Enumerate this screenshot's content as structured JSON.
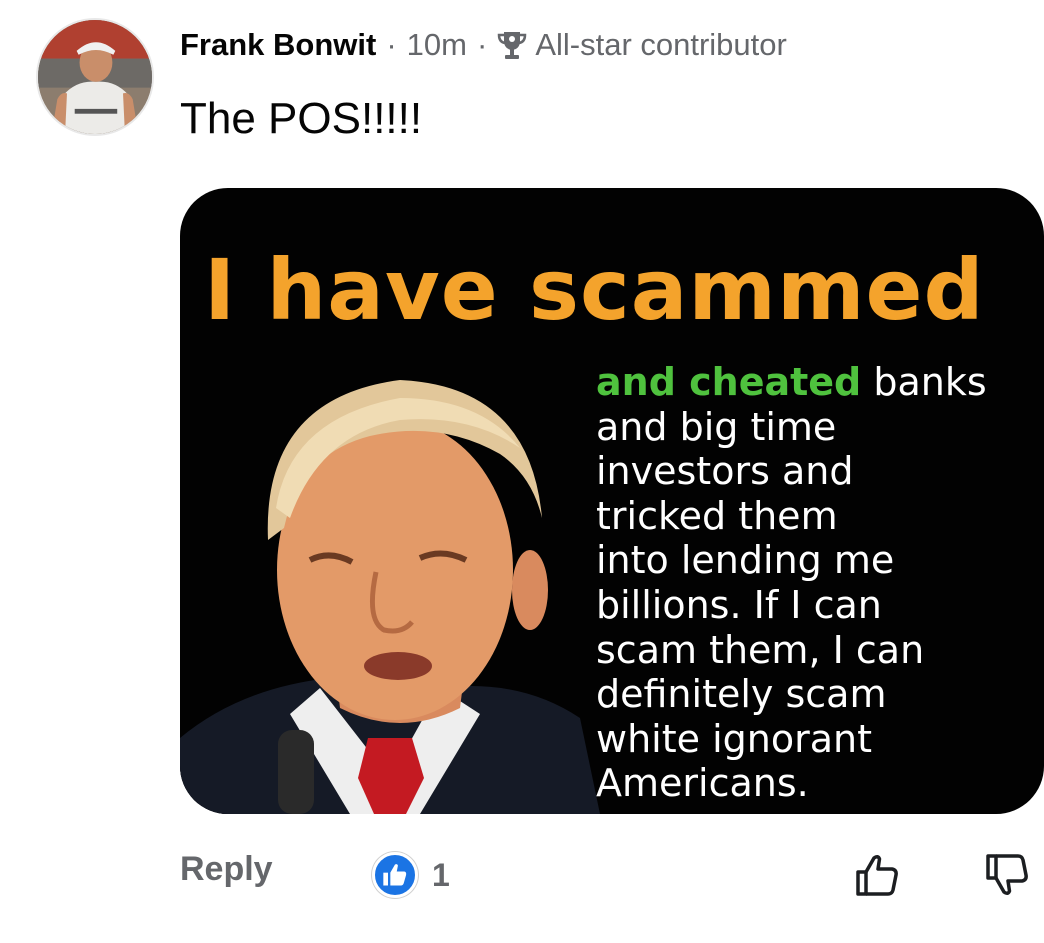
{
  "comment": {
    "author": "Frank Bonwit",
    "separator": "·",
    "time": "10m",
    "badge_label": "All-star contributor",
    "badge_icon": "trophy-icon",
    "text": "The POS!!!!!"
  },
  "meme": {
    "title": "I have scammed",
    "body_highlight": "and cheated",
    "body_lines": [
      " banks",
      "and big time",
      "investors and",
      "tricked them",
      "into lending me",
      "billions. If I can",
      "scam them, I can",
      "definitely scam",
      "white ignorant",
      "Americans."
    ],
    "colors": {
      "title": "#f4a32c",
      "highlight": "#4fc23e",
      "body": "#ffffff",
      "background": "#020202"
    }
  },
  "actions": {
    "reply_label": "Reply",
    "reaction_icon": "like-reaction-icon",
    "reaction_count": "1",
    "thumbs_up_icon": "thumbs-up-icon",
    "thumbs_down_icon": "thumbs-down-icon"
  },
  "colors": {
    "accent": "#1b74e4",
    "secondary_text": "#65676b"
  }
}
